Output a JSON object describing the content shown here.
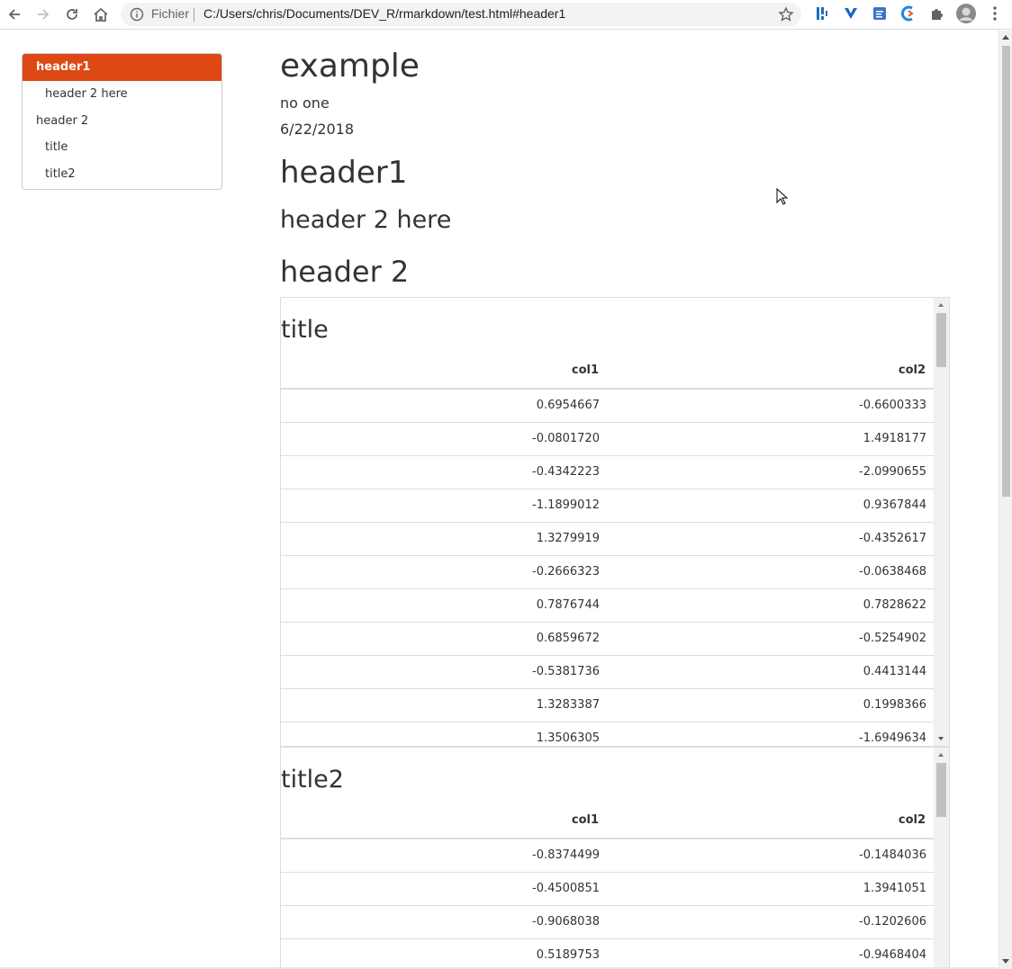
{
  "browser": {
    "scheme_label": "Fichier",
    "url": "C:/Users/chris/Documents/DEV_R/rmarkdown/test.html#header1",
    "icons": [
      "back-icon",
      "forward-icon",
      "reload-icon",
      "home-icon",
      "info-icon",
      "star-icon",
      "extension-icon",
      "puzzle-icon",
      "avatar",
      "menu-icon"
    ]
  },
  "toc": {
    "items": [
      {
        "label": "header1",
        "active": true
      },
      {
        "label": "header 2 here",
        "active": false
      },
      {
        "label": "header 2",
        "active": false
      },
      {
        "label": "title",
        "active": false
      },
      {
        "label": "title2",
        "active": false
      }
    ],
    "active_color": "#dd4814"
  },
  "doc": {
    "title": "example",
    "author": "no one",
    "date": "6/22/2018",
    "h1": "header1",
    "h2_here": "header 2 here",
    "h2": "header 2"
  },
  "tables": [
    {
      "title": "title",
      "columns": [
        "col1",
        "col2"
      ],
      "rows": [
        [
          "0.6954667",
          "-0.6600333"
        ],
        [
          "-0.0801720",
          "1.4918177"
        ],
        [
          "-0.4342223",
          "-2.0990655"
        ],
        [
          "-1.1899012",
          "0.9367844"
        ],
        [
          "1.3279919",
          "-0.4352617"
        ],
        [
          "-0.2666323",
          "-0.0638468"
        ],
        [
          "0.7876744",
          "0.7828622"
        ],
        [
          "0.6859672",
          "-0.5254902"
        ],
        [
          "-0.5381736",
          "0.4413144"
        ],
        [
          "1.3283387",
          "0.1998366"
        ],
        [
          "1.3506305",
          "-1.6949634"
        ]
      ]
    },
    {
      "title": "title2",
      "columns": [
        "col1",
        "col2"
      ],
      "rows": [
        [
          "-0.8374499",
          "-0.1484036"
        ],
        [
          "-0.4500851",
          "1.3941051"
        ],
        [
          "-0.9068038",
          "-0.1202606"
        ],
        [
          "0.5189753",
          "-0.9468404"
        ]
      ]
    }
  ]
}
